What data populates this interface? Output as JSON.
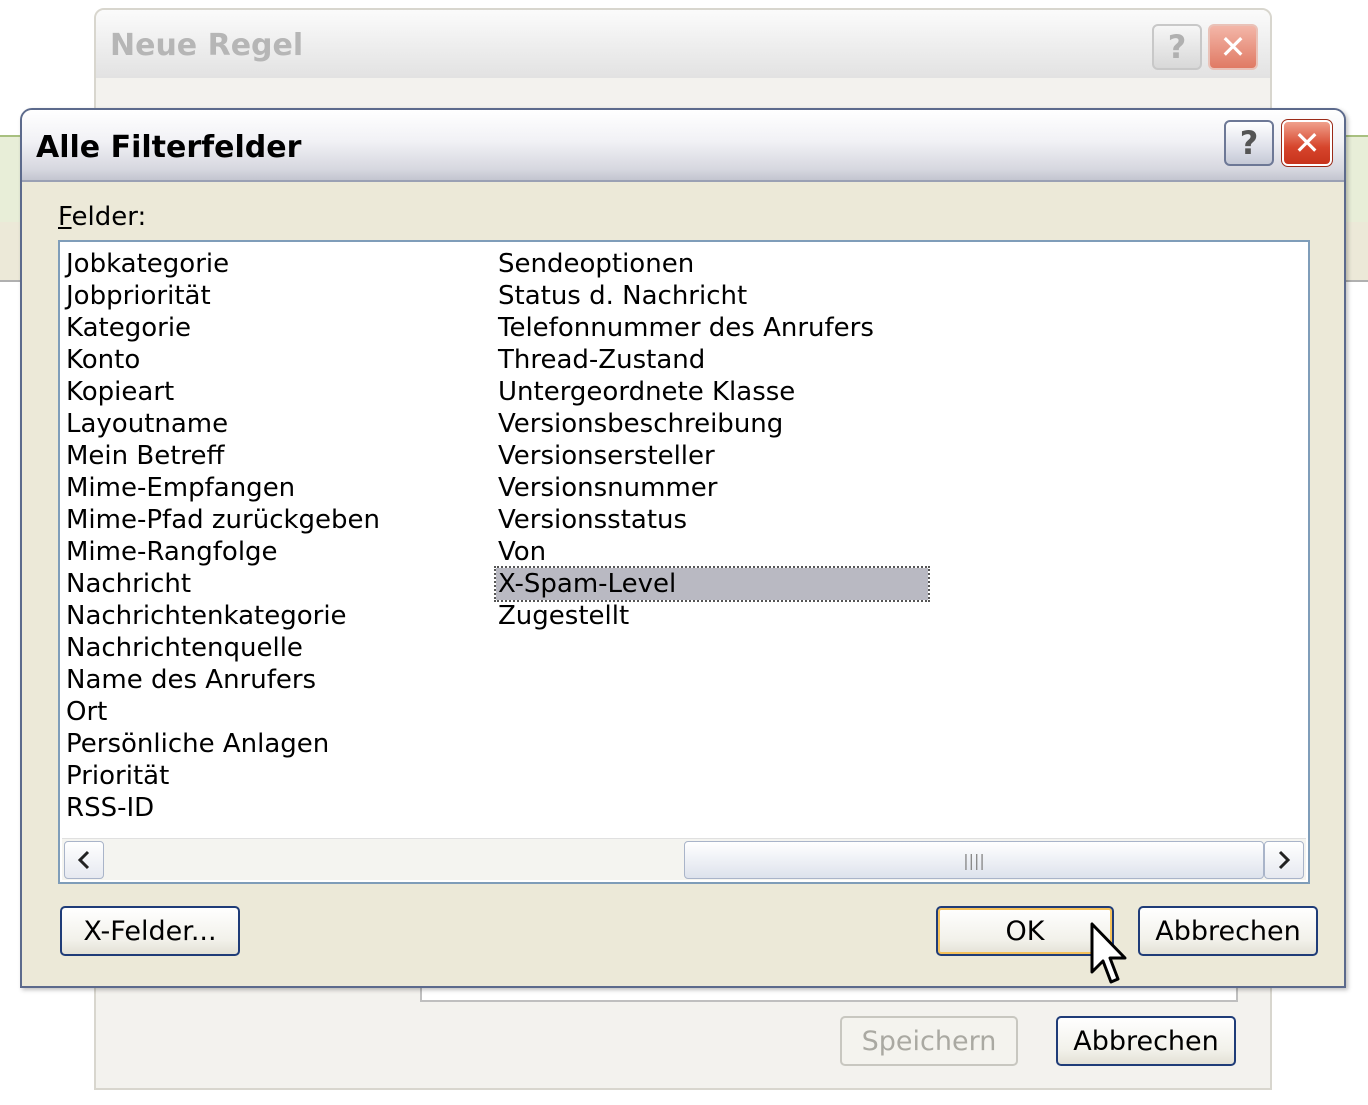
{
  "back_dialog": {
    "title": "Neue Regel",
    "help_label": "?",
    "close_label": "✕",
    "save_label": "Speichern",
    "cancel_label": "Abbrechen"
  },
  "dialog": {
    "title": "Alle Filterfelder",
    "help_label": "?",
    "close_label": "✕",
    "felder_label_first": "F",
    "felder_label_rest": "elder:",
    "fields_col1": [
      "Jobkategorie",
      "Jobpriorität",
      "Kategorie",
      "Konto",
      "Kopieart",
      "Layoutname",
      "Mein Betreff",
      "Mime-Empfangen",
      "Mime-Pfad zurückgeben",
      "Mime-Rangfolge",
      "Nachricht",
      "Nachrichtenkategorie",
      "Nachrichtenquelle",
      "Name des Anrufers",
      "Ort",
      "Persönliche Anlagen",
      "Priorität",
      "RSS-ID"
    ],
    "fields_col2": [
      "Sendeoptionen",
      "Status d. Nachricht",
      "Telefonnummer des Anrufers",
      "Thread-Zustand",
      "Untergeordnete Klasse",
      "Versionsbeschreibung",
      "Versionsersteller",
      "Versionsnummer",
      "Versionsstatus",
      "Von",
      "X-Spam-Level",
      "Zugestellt"
    ],
    "selected_field": "X-Spam-Level",
    "scroll_left_icon": "‹",
    "scroll_right_icon": "›",
    "scroll_thumb_grip": "||||",
    "xfelder_label": "X-Felder...",
    "ok_label": "OK",
    "cancel_label": "Abbrechen"
  }
}
